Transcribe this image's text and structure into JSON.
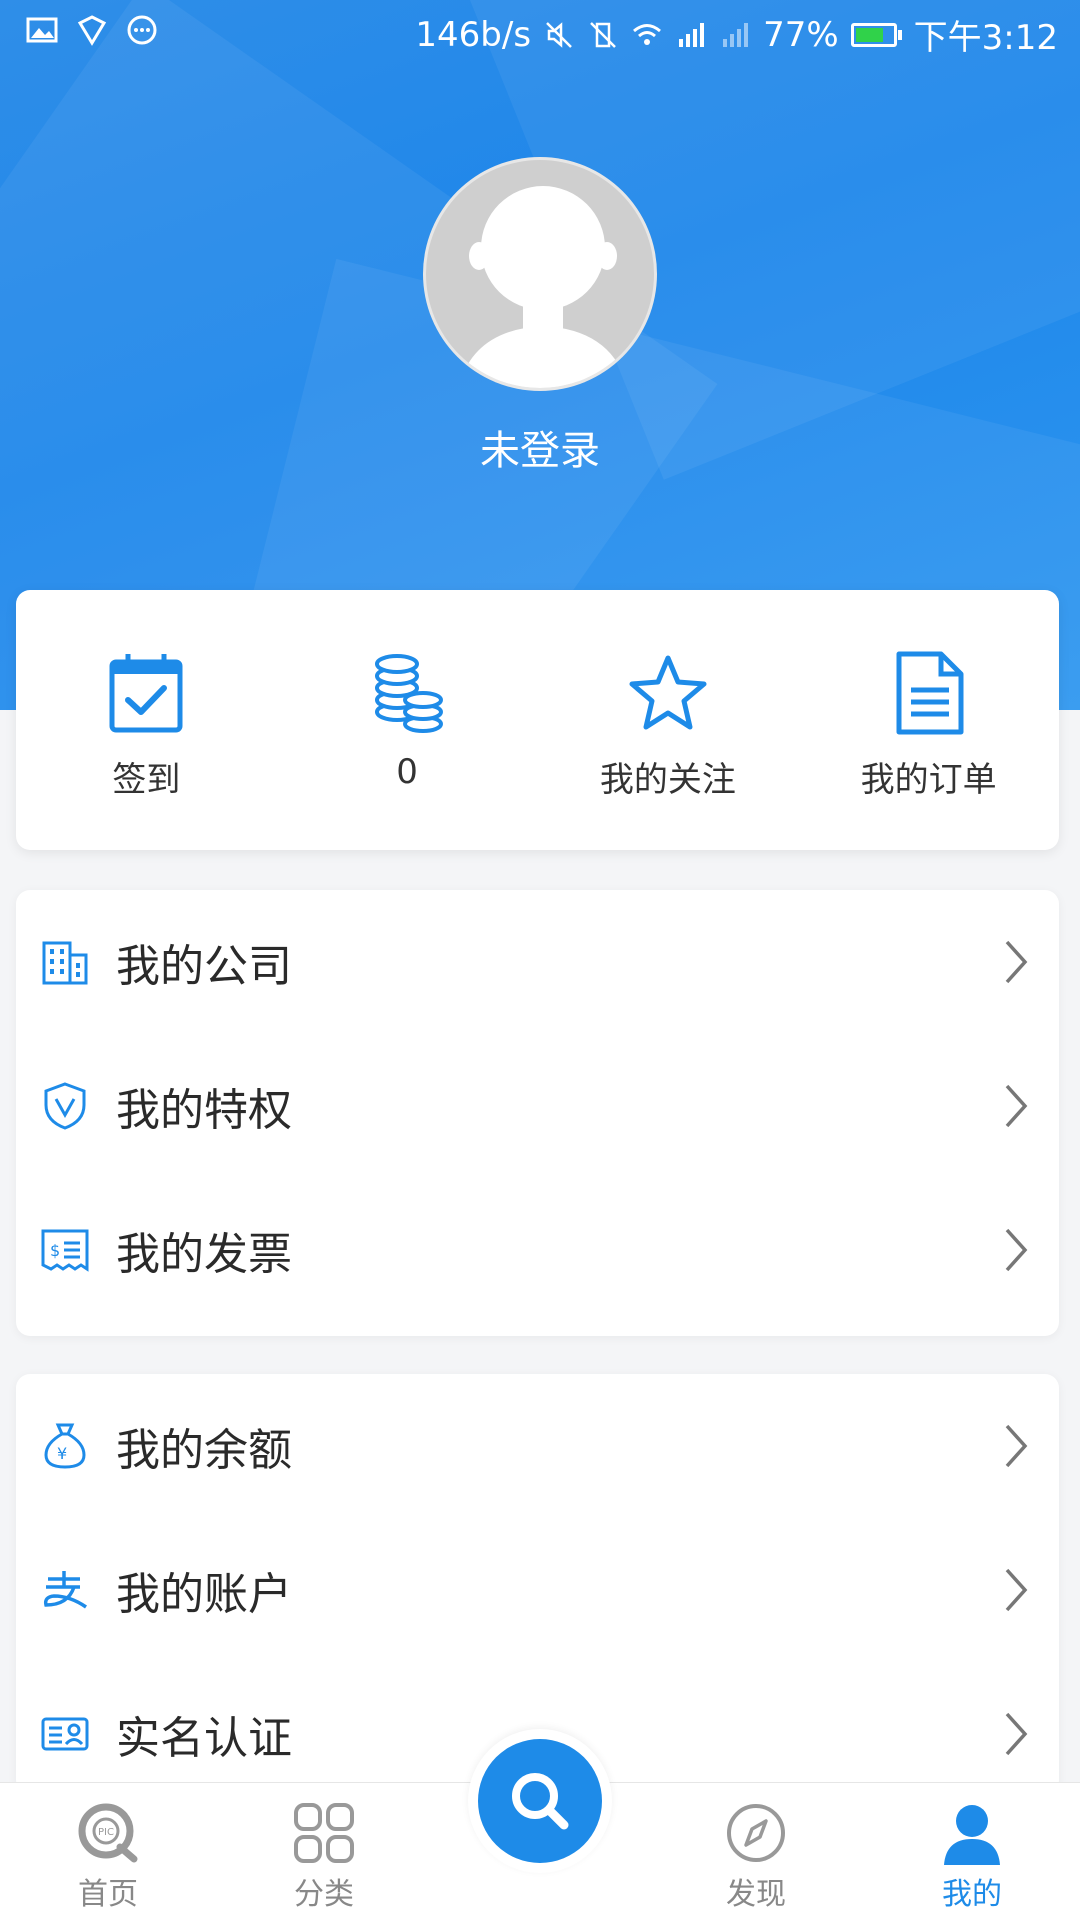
{
  "status_bar": {
    "net_speed": "146b/s",
    "battery_percent": "77%",
    "time": "下午3:12"
  },
  "profile": {
    "login_status": "未登录"
  },
  "quick_actions": [
    {
      "label": "签到",
      "icon": "calendar-check-icon"
    },
    {
      "label": "0",
      "icon": "coins-icon"
    },
    {
      "label": "我的关注",
      "icon": "star-icon"
    },
    {
      "label": "我的订单",
      "icon": "document-icon"
    }
  ],
  "menu_group_1": [
    {
      "label": "我的公司",
      "icon": "building-icon"
    },
    {
      "label": "我的特权",
      "icon": "shield-v-icon"
    },
    {
      "label": "我的发票",
      "icon": "invoice-icon"
    }
  ],
  "menu_group_2": [
    {
      "label": "我的余额",
      "icon": "money-bag-icon"
    },
    {
      "label": "我的账户",
      "icon": "alipay-icon"
    },
    {
      "label": "实名认证",
      "icon": "id-card-icon"
    }
  ],
  "bottom_nav": {
    "home": "首页",
    "category": "分类",
    "discover": "发现",
    "mine": "我的",
    "active": "mine"
  },
  "colors": {
    "accent": "#1e8be8",
    "header_bg": "#1d86ea",
    "battery": "#30d24a"
  }
}
